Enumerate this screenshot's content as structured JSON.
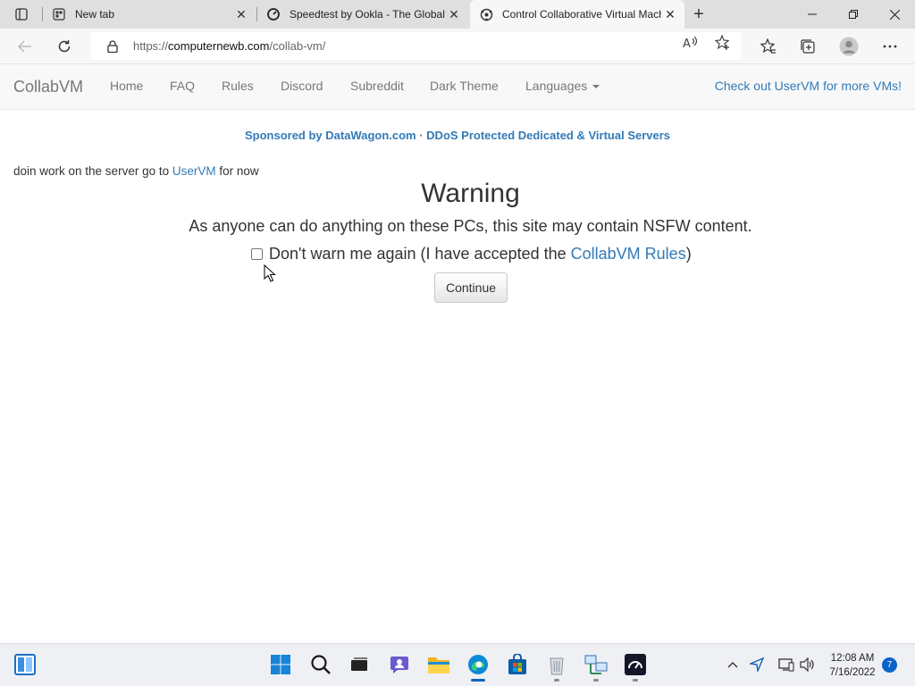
{
  "browser": {
    "tabs": [
      {
        "title": "New tab",
        "icon": "new-tab-page-icon",
        "active": false
      },
      {
        "title": "Speedtest by Ookla - The Global Broadband Speed Test",
        "icon": "speedtest-icon",
        "active": false
      },
      {
        "title": "Control Collaborative Virtual Machines!",
        "icon": "collabvm-icon",
        "active": true
      }
    ],
    "url_scheme": "https://",
    "url_host": "computernewb.com",
    "url_path": "/collab-vm/"
  },
  "site": {
    "brand": "CollabVM",
    "nav_items": [
      "Home",
      "FAQ",
      "Rules",
      "Discord",
      "Subreddit",
      "Dark Theme",
      "Languages"
    ],
    "nav_right": "Check out UserVM for more VMs!"
  },
  "content": {
    "sponsor": "Sponsored by DataWagon.com · DDoS Protected Dedicated & Virtual Servers",
    "notice_before": "doin work on the server go to ",
    "notice_link": "UserVM",
    "notice_after": " for now",
    "warning_title": "Warning",
    "warning_text": "As anyone can do anything on these PCs, this site may contain NSFW content.",
    "dont_warn_before": "Don't warn me again (I have accepted the ",
    "dont_warn_link": "CollabVM Rules",
    "dont_warn_after": ")",
    "continue_label": "Continue"
  },
  "taskbar": {
    "clock_time": "12:08 AM",
    "clock_date": "7/16/2022",
    "notification_count": "7"
  },
  "colors": {
    "link": "#337ab7",
    "taskbar_accent": "#0067c0"
  }
}
